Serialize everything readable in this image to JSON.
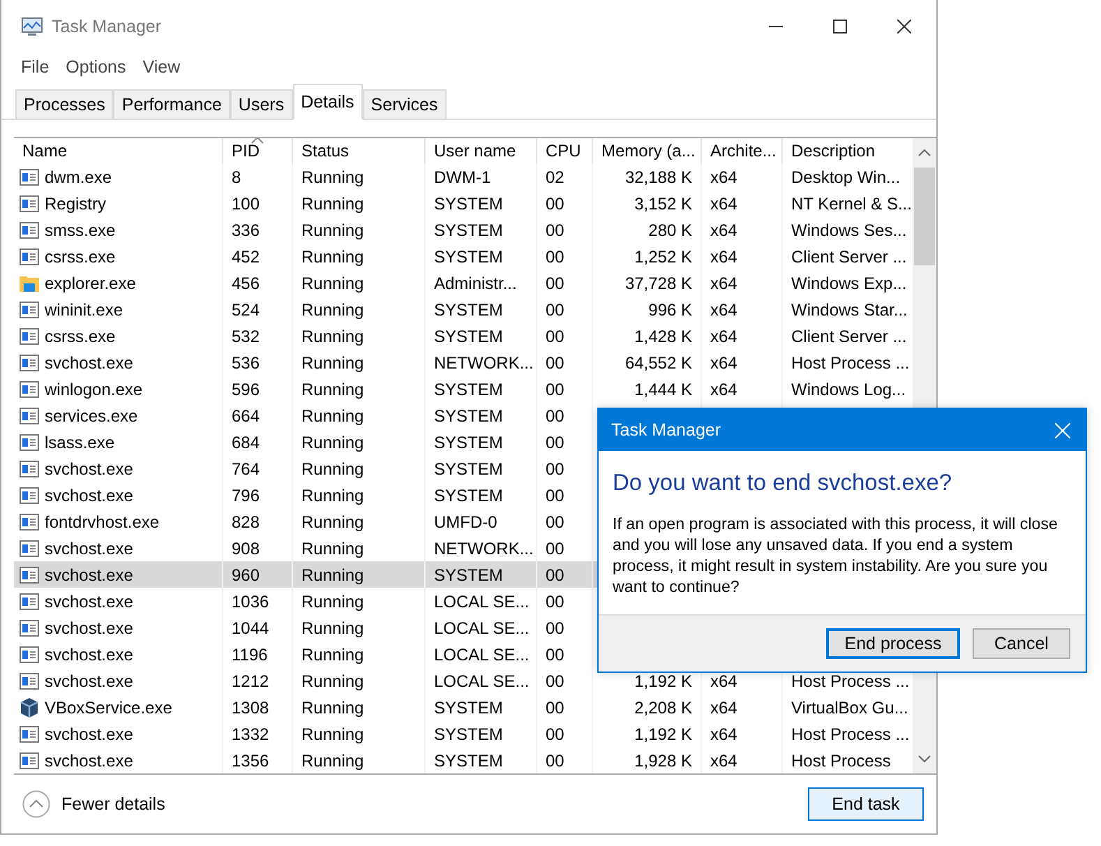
{
  "window": {
    "title": "Task Manager"
  },
  "menu": [
    "File",
    "Options",
    "View"
  ],
  "tabs": [
    {
      "label": "Processes",
      "selected": false
    },
    {
      "label": "Performance",
      "selected": false
    },
    {
      "label": "Users",
      "selected": false
    },
    {
      "label": "Details",
      "selected": true
    },
    {
      "label": "Services",
      "selected": false
    }
  ],
  "table": {
    "columns": [
      "Name",
      "PID",
      "Status",
      "User name",
      "CPU",
      "Memory (a...",
      "Archite...",
      "Description"
    ],
    "rows": [
      {
        "kind": "app",
        "name": "dwm.exe",
        "pid": "8",
        "status": "Running",
        "user": "DWM-1",
        "cpu": "02",
        "memory": "32,188 K",
        "arch": "x64",
        "description": "Desktop Win...",
        "selected": false
      },
      {
        "kind": "app",
        "name": "Registry",
        "pid": "100",
        "status": "Running",
        "user": "SYSTEM",
        "cpu": "00",
        "memory": "3,152 K",
        "arch": "x64",
        "description": "NT Kernel & S...",
        "selected": false
      },
      {
        "kind": "app",
        "name": "smss.exe",
        "pid": "336",
        "status": "Running",
        "user": "SYSTEM",
        "cpu": "00",
        "memory": "280 K",
        "arch": "x64",
        "description": "Windows Ses...",
        "selected": false
      },
      {
        "kind": "app",
        "name": "csrss.exe",
        "pid": "452",
        "status": "Running",
        "user": "SYSTEM",
        "cpu": "00",
        "memory": "1,252 K",
        "arch": "x64",
        "description": "Client Server ...",
        "selected": false
      },
      {
        "kind": "folder",
        "name": "explorer.exe",
        "pid": "456",
        "status": "Running",
        "user": "Administr...",
        "cpu": "00",
        "memory": "37,728 K",
        "arch": "x64",
        "description": "Windows Exp...",
        "selected": false
      },
      {
        "kind": "app",
        "name": "wininit.exe",
        "pid": "524",
        "status": "Running",
        "user": "SYSTEM",
        "cpu": "00",
        "memory": "996 K",
        "arch": "x64",
        "description": "Windows Star...",
        "selected": false
      },
      {
        "kind": "app",
        "name": "csrss.exe",
        "pid": "532",
        "status": "Running",
        "user": "SYSTEM",
        "cpu": "00",
        "memory": "1,428 K",
        "arch": "x64",
        "description": "Client Server ...",
        "selected": false
      },
      {
        "kind": "app",
        "name": "svchost.exe",
        "pid": "536",
        "status": "Running",
        "user": "NETWORK...",
        "cpu": "00",
        "memory": "64,552 K",
        "arch": "x64",
        "description": "Host Process ...",
        "selected": false
      },
      {
        "kind": "app",
        "name": "winlogon.exe",
        "pid": "596",
        "status": "Running",
        "user": "SYSTEM",
        "cpu": "00",
        "memory": "1,444 K",
        "arch": "x64",
        "description": "Windows Log...",
        "selected": false
      },
      {
        "kind": "app",
        "name": "services.exe",
        "pid": "664",
        "status": "Running",
        "user": "SYSTEM",
        "cpu": "00",
        "selected": false
      },
      {
        "kind": "app",
        "name": "lsass.exe",
        "pid": "684",
        "status": "Running",
        "user": "SYSTEM",
        "cpu": "00",
        "selected": false
      },
      {
        "kind": "app",
        "name": "svchost.exe",
        "pid": "764",
        "status": "Running",
        "user": "SYSTEM",
        "cpu": "00",
        "selected": false
      },
      {
        "kind": "app",
        "name": "svchost.exe",
        "pid": "796",
        "status": "Running",
        "user": "SYSTEM",
        "cpu": "00",
        "selected": false
      },
      {
        "kind": "app",
        "name": "fontdrvhost.exe",
        "pid": "828",
        "status": "Running",
        "user": "UMFD-0",
        "cpu": "00",
        "selected": false
      },
      {
        "kind": "app",
        "name": "svchost.exe",
        "pid": "908",
        "status": "Running",
        "user": "NETWORK...",
        "cpu": "00",
        "selected": false
      },
      {
        "kind": "app",
        "name": "svchost.exe",
        "pid": "960",
        "status": "Running",
        "user": "SYSTEM",
        "cpu": "00",
        "selected": true
      },
      {
        "kind": "app",
        "name": "svchost.exe",
        "pid": "1036",
        "status": "Running",
        "user": "LOCAL SE...",
        "cpu": "00",
        "selected": false
      },
      {
        "kind": "app",
        "name": "svchost.exe",
        "pid": "1044",
        "status": "Running",
        "user": "LOCAL SE...",
        "cpu": "00",
        "selected": false
      },
      {
        "kind": "app",
        "name": "svchost.exe",
        "pid": "1196",
        "status": "Running",
        "user": "LOCAL SE...",
        "cpu": "00",
        "selected": false
      },
      {
        "kind": "app",
        "name": "svchost.exe",
        "pid": "1212",
        "status": "Running",
        "user": "LOCAL SE...",
        "cpu": "00",
        "memory": "1,192 K",
        "arch": "x64",
        "description": "Host Process ...",
        "selected": false
      },
      {
        "kind": "vbox",
        "name": "VBoxService.exe",
        "pid": "1308",
        "status": "Running",
        "user": "SYSTEM",
        "cpu": "00",
        "memory": "2,208 K",
        "arch": "x64",
        "description": "VirtualBox Gu...",
        "selected": false
      },
      {
        "kind": "app",
        "name": "svchost.exe",
        "pid": "1332",
        "status": "Running",
        "user": "SYSTEM",
        "cpu": "00",
        "memory": "1,192 K",
        "arch": "x64",
        "description": "Host Process ...",
        "selected": false
      },
      {
        "kind": "app",
        "name": "svchost.exe",
        "pid": "1356",
        "status": "Running",
        "user": "SYSTEM",
        "cpu": "00",
        "memory": "1,928 K",
        "arch": "x64",
        "description": "Host Process",
        "selected": false
      }
    ]
  },
  "footer": {
    "toggle": "Fewer details",
    "button": "End task"
  },
  "dialog": {
    "title": "Task Manager",
    "heading": "Do you want to end svchost.exe?",
    "message": "If an open program is associated with this process, it will close and you will lose any unsaved data. If you end a system process, it might result in system instability. Are you sure you want to continue?",
    "buttons": [
      {
        "label": "End process",
        "default": true
      },
      {
        "label": "Cancel",
        "default": false
      }
    ]
  }
}
